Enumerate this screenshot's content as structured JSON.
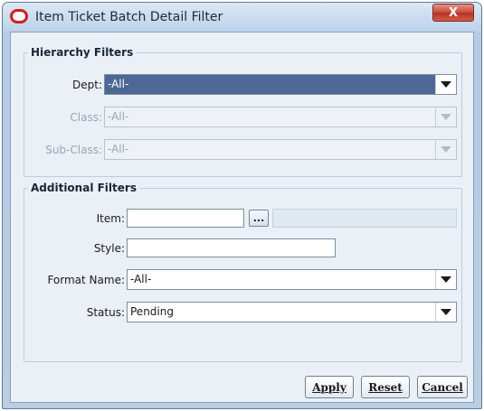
{
  "window": {
    "title": "Item Ticket Batch Detail Filter",
    "close_label": "X"
  },
  "hierarchy": {
    "legend": "Hierarchy Filters",
    "dept": {
      "label": "Dept:",
      "value": "-All-"
    },
    "class": {
      "label": "Class:",
      "value": "-All-"
    },
    "subclass": {
      "label": "Sub-Class:",
      "value": "-All-"
    }
  },
  "additional": {
    "legend": "Additional Filters",
    "item": {
      "label": "Item:",
      "value": "",
      "lookup_label": "..."
    },
    "style": {
      "label": "Style:",
      "value": ""
    },
    "format_name": {
      "label": "Format Name:",
      "value": "-All-"
    },
    "status": {
      "label": "Status:",
      "value": "Pending"
    }
  },
  "buttons": {
    "apply": "Apply",
    "reset": "Reset",
    "cancel": "Cancel"
  },
  "colors": {
    "selected_dropdown": "#4d6895",
    "close_button": "#c9473a",
    "app_icon": "#d02020"
  }
}
